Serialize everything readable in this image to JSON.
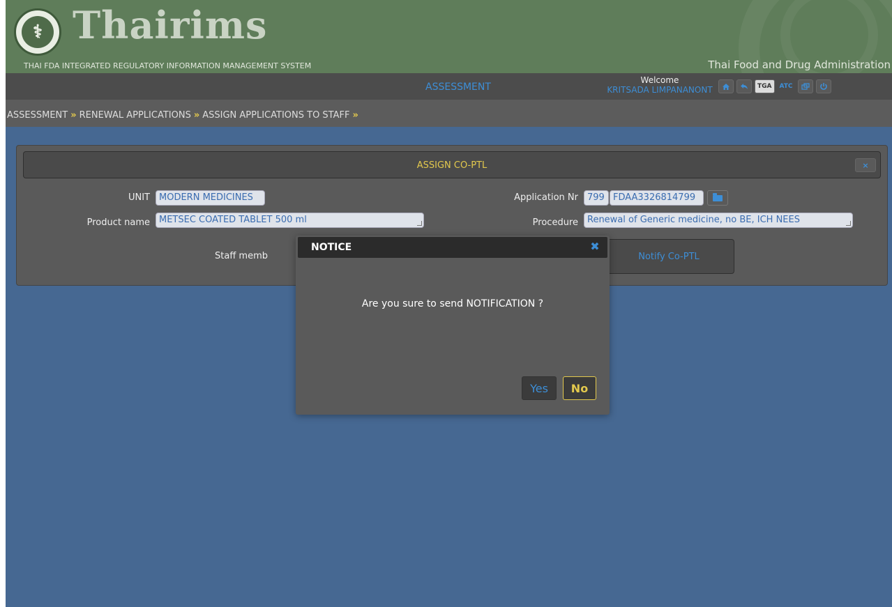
{
  "colors": {
    "accent_blue": "#3d8ed6",
    "accent_yellow": "#e3c94d",
    "page_background": "#466892",
    "banner_green": "#5f7d5a"
  },
  "header": {
    "brand": "Thairims",
    "subtitle": "THAI FDA INTEGRATED REGULATORY INFORMATION MANAGEMENT SYSTEM",
    "agency": "Thai Food and Drug Administration",
    "logo_icon": "fda-seal-logo"
  },
  "navbar": {
    "module": "ASSESSMENT",
    "welcome_label": "Welcome",
    "user_name": "KRITSADA LIMPANANONT",
    "icons": {
      "home": "home-icon",
      "back": "back-arrow-icon",
      "tga": "TGA",
      "atc": "ATC",
      "window": "window-icon",
      "power": "power-icon"
    }
  },
  "breadcrumb": {
    "items": [
      "ASSESSMENT",
      "RENEWAL APPLICATIONS",
      "ASSIGN APPLICATIONS TO STAFF"
    ],
    "separator": "»"
  },
  "panel": {
    "title": "ASSIGN CO-PTL",
    "close_label": "×",
    "unit_label": "UNIT",
    "unit_value": "MODERN MEDICINES",
    "product_label": "Product name",
    "product_value": "METSEC COATED TABLET 500 ml",
    "appnr_label": "Application Nr",
    "appnr_prefix": "799",
    "appnr_value": "FDAA3326814799",
    "procedure_label": "Procedure",
    "procedure_value": "Renewal of Generic medicine, no BE, ICH NEES",
    "staff_label": "Staff memb",
    "notify_label": "Notify Co-PTL"
  },
  "modal": {
    "title": "NOTICE",
    "close_label": "✖",
    "message": "Are you sure to send NOTIFICATION ?",
    "yes_label": "Yes",
    "no_label": "No"
  }
}
